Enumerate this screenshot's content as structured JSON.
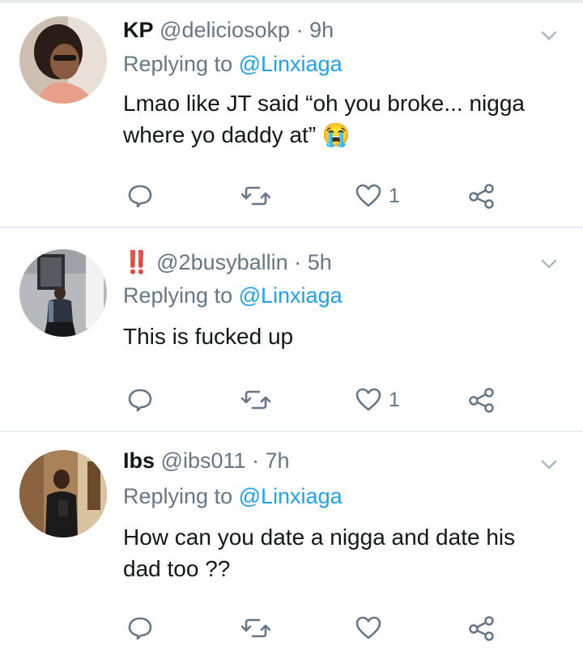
{
  "tweets": [
    {
      "name": "KP",
      "handle": "@deliciosokp",
      "dot": "·",
      "time": "9h",
      "replying_prefix": "Replying to",
      "replying_to": "@Linxiaga",
      "text_line1": "Lmao like JT said “oh you broke... nigga",
      "text_line2": "where yo daddy at”",
      "emoji": "😭",
      "like_count": "1"
    },
    {
      "name": "‼️",
      "handle": "@2busyballin",
      "dot": "·",
      "time": "5h",
      "replying_prefix": "Replying to",
      "replying_to": "@Linxiaga",
      "text_line1": "This is fucked up",
      "like_count": "1"
    },
    {
      "name": "Ibs",
      "handle": "@ibs011",
      "dot": "·",
      "time": "7h",
      "replying_prefix": "Replying to",
      "replying_to": "@Linxiaga",
      "text_line1": "How can you date a nigga and date his",
      "text_line2": "dad too ??"
    }
  ],
  "icons": {
    "reply": "reply-icon",
    "retweet": "retweet-icon",
    "like": "heart-icon",
    "share": "share-icon",
    "more": "chevron-down-icon"
  },
  "colors": {
    "text": "#14171a",
    "secondary": "#657786",
    "link": "#1da1f2",
    "divider": "#e6ecf0"
  }
}
